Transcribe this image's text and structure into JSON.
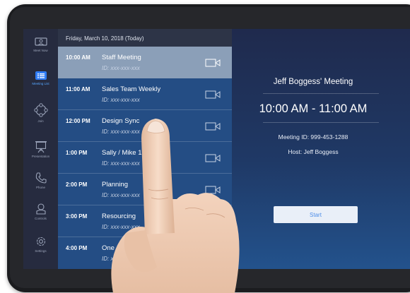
{
  "rail": {
    "items": [
      {
        "label": "Meet Now",
        "icon": "monitor-icon"
      },
      {
        "label": "Meeting List",
        "icon": "list-icon",
        "active": true
      },
      {
        "label": "Join",
        "icon": "join-icon"
      },
      {
        "label": "Presentation",
        "icon": "presentation-icon"
      },
      {
        "label": "Phone",
        "icon": "phone-icon"
      },
      {
        "label": "Controls",
        "icon": "controls-icon"
      },
      {
        "label": "Settings",
        "icon": "settings-icon"
      }
    ]
  },
  "schedule": {
    "date_header": "Friday, March 10, 2018 (Today)",
    "meetings": [
      {
        "time": "10:00 AM",
        "title": "Staff Meeting",
        "id_text": "ID: xxx-xxx-xxx",
        "selected": true
      },
      {
        "time": "11:00 AM",
        "title": "Sales Team Weekly",
        "id_text": "ID: xxx-xxx-xxx"
      },
      {
        "time": "12:00 PM",
        "title": "Design Sync",
        "id_text": "ID: xxx-xxx-xxx"
      },
      {
        "time": "1:00 PM",
        "title": "Sally / Mike 1:1",
        "id_text": "ID: xxx-xxx-xxx"
      },
      {
        "time": "2:00 PM",
        "title": "Planning",
        "id_text": "ID: xxx-xxx-xxx"
      },
      {
        "time": "3:00 PM",
        "title": "Resourcing",
        "id_text": "ID: xxx-xxx-xxx"
      },
      {
        "time": "4:00 PM",
        "title": "One on",
        "id_text": "ID: xxx"
      }
    ]
  },
  "detail": {
    "title": "Jeff Boggess' Meeting",
    "time_range": "10:00 AM - 11:00 AM",
    "meeting_id": "Meeting ID: 999-453-1288",
    "host": "Host: Jeff Boggess",
    "start_label": "Start"
  },
  "colors": {
    "accent": "#56a7ff",
    "list_bg": "#244d84",
    "selected_row": "#8b9fb8",
    "start_text": "#4d8de8"
  }
}
